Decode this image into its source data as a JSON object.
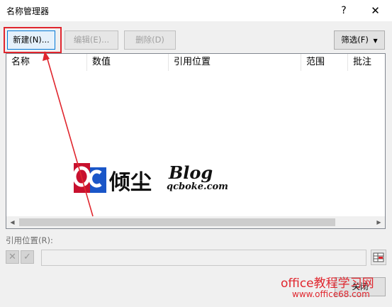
{
  "window": {
    "title": "名称管理器",
    "help_glyph": "?",
    "close_glyph": "✕"
  },
  "toolbar": {
    "new_label": "新建(N)...",
    "edit_label": "编辑(E)...",
    "delete_label": "删除(D)",
    "filter_label": "筛选(F)",
    "filter_arrow": "▼"
  },
  "table": {
    "columns": [
      "名称",
      "数值",
      "引用位置",
      "范围",
      "批注"
    ],
    "rows": []
  },
  "refers_to": {
    "label": "引用位置(R):",
    "cancel_glyph": "✕",
    "ok_glyph": "✓",
    "value": ""
  },
  "footer": {
    "close_label": "关闭"
  },
  "watermarks": {
    "blog_name": "倾尘",
    "blog_word": "Blog",
    "blog_domain": "qcboke.com",
    "site_name": "office教程学习网",
    "site_url": "www.office68.com"
  },
  "colors": {
    "highlight": "#e0262e",
    "accent": "#0078d7",
    "logo_red": "#c8102e",
    "logo_blue": "#1a56c8"
  }
}
